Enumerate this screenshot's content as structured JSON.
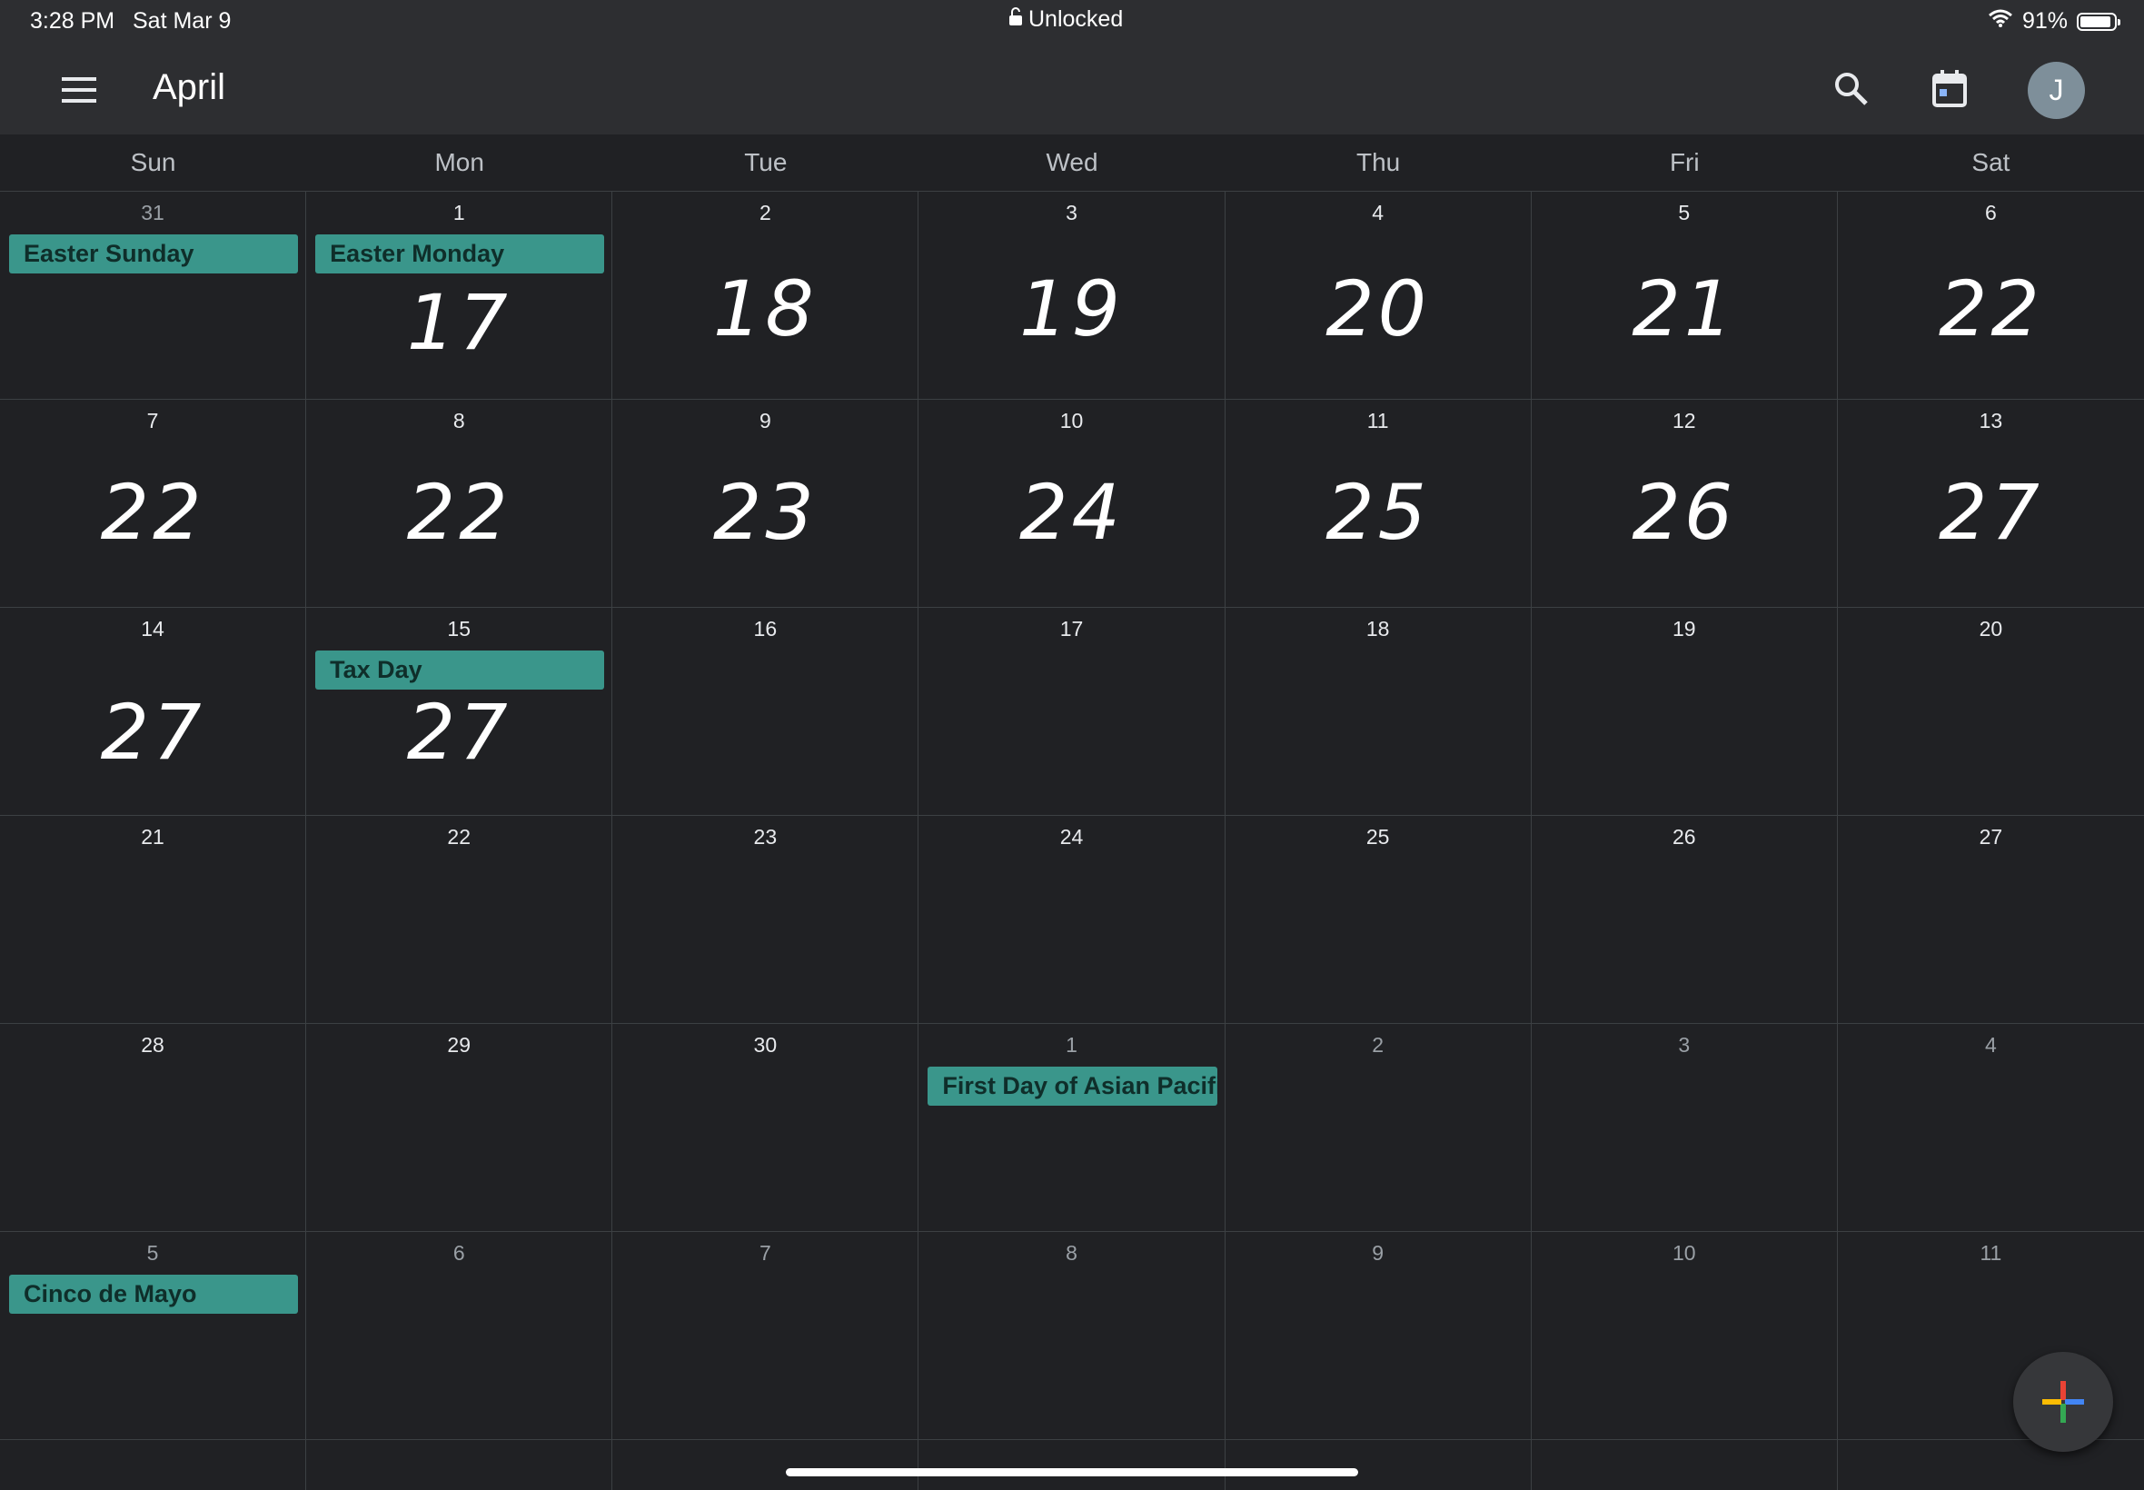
{
  "status": {
    "time": "3:28 PM",
    "date": "Sat Mar 9",
    "lock_text": "Unlocked",
    "battery": "91%",
    "battery_level": 0.91
  },
  "header": {
    "title": "April",
    "avatar_letter": "J"
  },
  "weekdays": [
    "Sun",
    "Mon",
    "Tue",
    "Wed",
    "Thu",
    "Fri",
    "Sat"
  ],
  "weeks": [
    [
      {
        "day": "31",
        "dim": true,
        "event": "Easter Sunday"
      },
      {
        "day": "1",
        "event": "Easter Monday",
        "handwriting": "17"
      },
      {
        "day": "2",
        "handwriting": "18"
      },
      {
        "day": "3",
        "handwriting": "19"
      },
      {
        "day": "4",
        "handwriting": "20"
      },
      {
        "day": "5",
        "handwriting": "21"
      },
      {
        "day": "6",
        "handwriting": "22"
      }
    ],
    [
      {
        "day": "7",
        "handwriting": "22"
      },
      {
        "day": "8",
        "handwriting": "22"
      },
      {
        "day": "9",
        "handwriting": "23"
      },
      {
        "day": "10",
        "handwriting": "24"
      },
      {
        "day": "11",
        "handwriting": "25"
      },
      {
        "day": "12",
        "handwriting": "26"
      },
      {
        "day": "13",
        "handwriting": "27"
      }
    ],
    [
      {
        "day": "14",
        "handwriting": "27"
      },
      {
        "day": "15",
        "event": "Tax Day",
        "handwriting": "27"
      },
      {
        "day": "16"
      },
      {
        "day": "17"
      },
      {
        "day": "18"
      },
      {
        "day": "19"
      },
      {
        "day": "20"
      }
    ],
    [
      {
        "day": "21"
      },
      {
        "day": "22"
      },
      {
        "day": "23"
      },
      {
        "day": "24"
      },
      {
        "day": "25"
      },
      {
        "day": "26"
      },
      {
        "day": "27"
      }
    ],
    [
      {
        "day": "28"
      },
      {
        "day": "29"
      },
      {
        "day": "30"
      },
      {
        "day": "1",
        "dim": true,
        "event": "First Day of Asian Pacific"
      },
      {
        "day": "2",
        "dim": true
      },
      {
        "day": "3",
        "dim": true
      },
      {
        "day": "4",
        "dim": true
      }
    ],
    [
      {
        "day": "5",
        "dim": true,
        "event": "Cinco de Mayo"
      },
      {
        "day": "6",
        "dim": true
      },
      {
        "day": "7",
        "dim": true
      },
      {
        "day": "8",
        "dim": true
      },
      {
        "day": "9",
        "dim": true
      },
      {
        "day": "10",
        "dim": true
      },
      {
        "day": "11",
        "dim": true
      }
    ]
  ],
  "colors": {
    "background": "#202124",
    "header_bg": "#2d2e31",
    "event_bg": "#3a968b",
    "grid_line": "#3c4043"
  }
}
